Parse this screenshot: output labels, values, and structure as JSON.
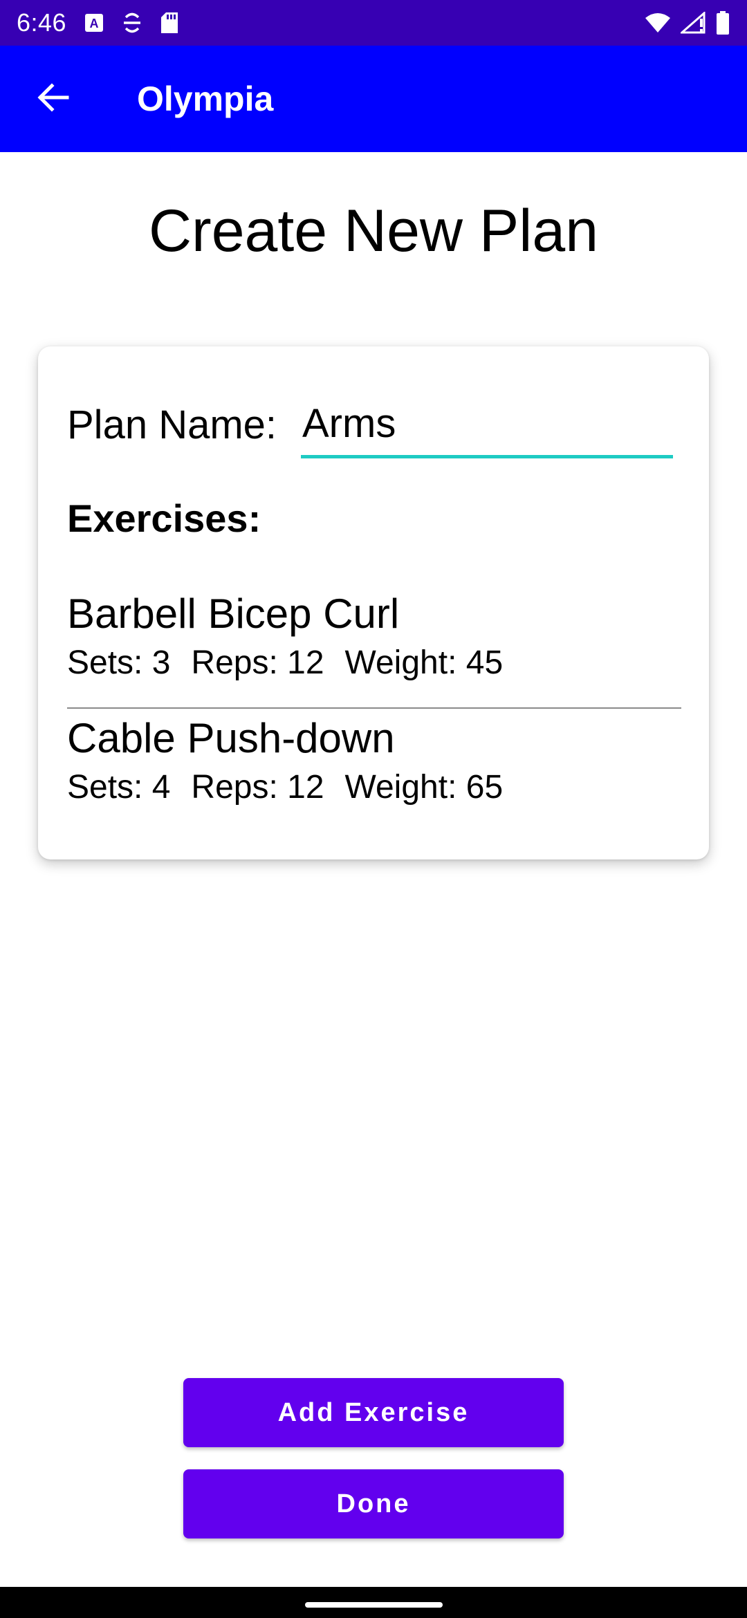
{
  "status_bar": {
    "time": "6:46",
    "left_icons": [
      "text-a-icon",
      "transfer-icon",
      "sd-card-icon"
    ],
    "right_icons": [
      "wifi-icon",
      "signal-icon",
      "battery-icon"
    ]
  },
  "app_bar": {
    "title": "Olympia",
    "back_icon": "arrow-left-icon",
    "color": "#0000ff"
  },
  "page": {
    "title": "Create New Plan"
  },
  "form": {
    "plan_name_label": "Plan Name:",
    "plan_name_value": "Arms",
    "exercises_heading": "Exercises:",
    "accent_color": "#1ecbc3"
  },
  "exercises": [
    {
      "name": "Barbell Bicep Curl",
      "sets": "Sets: 3",
      "reps": "Reps: 12",
      "weight": "Weight: 45"
    },
    {
      "name": "Cable Push-down",
      "sets": "Sets: 4",
      "reps": "Reps: 12",
      "weight": "Weight: 65"
    }
  ],
  "buttons": {
    "add_exercise": "Add Exercise",
    "done": "Done",
    "color": "#6200ee"
  }
}
